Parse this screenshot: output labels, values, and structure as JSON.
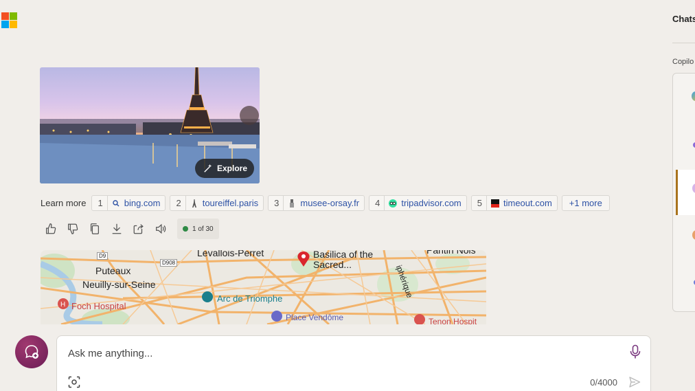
{
  "app": {
    "logo": "microsoft-logo",
    "logo_colors": [
      "#f25022",
      "#7fba00",
      "#00a4ef",
      "#ffb900"
    ]
  },
  "hero_card": {
    "image": "eiffel-tower-paris-photo",
    "explore_label": "Explore"
  },
  "learn_more": {
    "label": "Learn more",
    "sources": [
      {
        "num": "1",
        "domain": "bing.com",
        "icon": "bing-search-icon"
      },
      {
        "num": "2",
        "domain": "toureiffel.paris",
        "icon": "eiffel-icon"
      },
      {
        "num": "3",
        "domain": "musee-orsay.fr",
        "icon": "musee-orsay-icon"
      },
      {
        "num": "4",
        "domain": "tripadvisor.com",
        "icon": "tripadvisor-icon"
      },
      {
        "num": "5",
        "domain": "timeout.com",
        "icon": "timeout-icon"
      }
    ],
    "more_label": "+1 more"
  },
  "actions": {
    "icons": [
      "thumbs-up-icon",
      "thumbs-down-icon",
      "copy-icon",
      "download-icon",
      "share-icon",
      "speaker-icon"
    ],
    "counter": "1 of 30",
    "counter_color": "#2f8a45"
  },
  "map": {
    "labels": {
      "levallois": "Levallois-Perret",
      "basilica": "Basilica of the",
      "sacred": "Sacred...",
      "pantin": "Pantin Nois",
      "puteaux": "Puteaux",
      "neuilly": "Neuilly-sur-Seine",
      "foch": "Foch Hospital",
      "arc": "Arc de Triomphe",
      "vendome": "Place Vendôme",
      "tenon": "Tenon Hospit",
      "periph": "iphérique",
      "d9": "D9",
      "d908": "D908"
    }
  },
  "composer": {
    "placeholder": "Ask me anything...",
    "char_count": "0/4000",
    "icons": [
      "new-topic-icon",
      "microphone-icon",
      "image-scan-icon",
      "send-icon"
    ]
  },
  "right_panel": {
    "chats_title": "Chats",
    "copilot_label": "Copilo",
    "accent": "#a9731d"
  }
}
